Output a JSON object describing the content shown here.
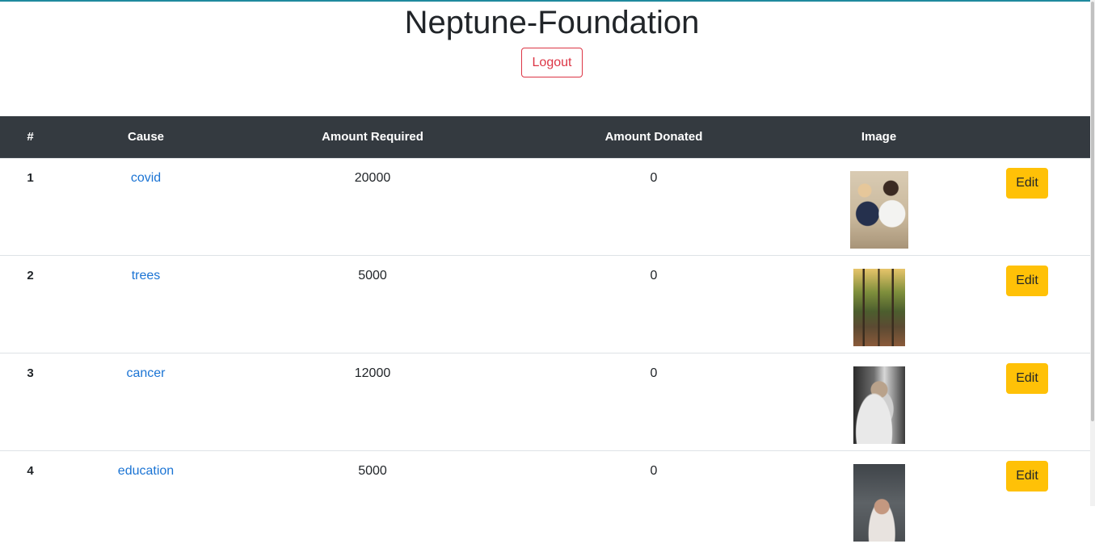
{
  "header": {
    "title": "Neptune-Foundation",
    "logout_label": "Logout"
  },
  "table": {
    "columns": [
      "#",
      "Cause",
      "Amount Required",
      "Amount Donated",
      "Image",
      ""
    ],
    "rows": [
      {
        "num": "1",
        "cause": "covid",
        "required": "20000",
        "donated": "0",
        "image_icon": "covid-photo",
        "edit_label": "Edit"
      },
      {
        "num": "2",
        "cause": "trees",
        "required": "5000",
        "donated": "0",
        "image_icon": "trees-photo",
        "edit_label": "Edit"
      },
      {
        "num": "3",
        "cause": "cancer",
        "required": "12000",
        "donated": "0",
        "image_icon": "cancer-photo",
        "edit_label": "Edit"
      },
      {
        "num": "4",
        "cause": "education",
        "required": "5000",
        "donated": "0",
        "image_icon": "education-photo",
        "edit_label": "Edit"
      }
    ]
  },
  "colors": {
    "header_bg": "#343a40",
    "link": "#1b74d4",
    "logout": "#dc3545",
    "edit": "#ffc107"
  }
}
